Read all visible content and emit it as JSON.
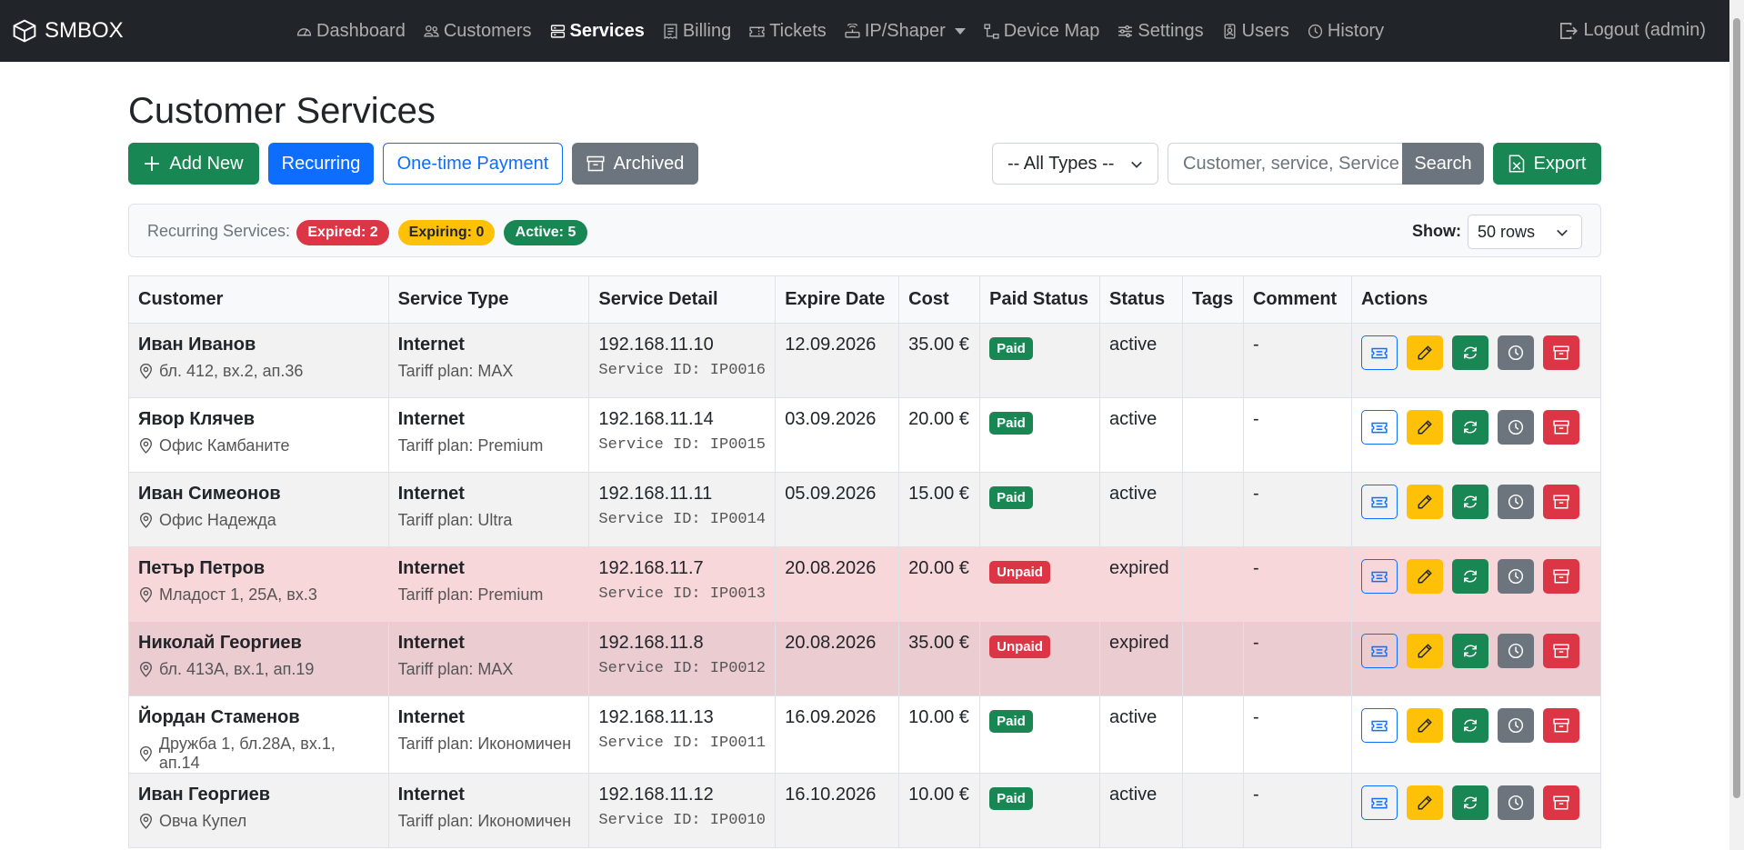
{
  "navbar": {
    "brand": "SMBOX",
    "links": [
      {
        "label": "Dashboard",
        "icon": "speedometer-icon"
      },
      {
        "label": "Customers",
        "icon": "people-icon"
      },
      {
        "label": "Services",
        "icon": "server-icon",
        "active": true
      },
      {
        "label": "Billing",
        "icon": "receipt-icon"
      },
      {
        "label": "Tickets",
        "icon": "ticket-icon"
      },
      {
        "label": "IP/Shaper",
        "icon": "router-icon"
      },
      {
        "label": "Device Map",
        "icon": "diagram-icon"
      },
      {
        "label": "Settings",
        "icon": "sliders-icon"
      },
      {
        "label": "Users",
        "icon": "person-badge-icon"
      },
      {
        "label": "History",
        "icon": "clock-icon"
      }
    ],
    "logout": "Logout (admin)"
  },
  "page": {
    "title": "Customer Services"
  },
  "toolbar": {
    "add_new": "Add New",
    "recurring": "Recurring",
    "one_time": "One-time Payment",
    "archived": "Archived",
    "type_filter": "-- All Types --",
    "search_placeholder": "Customer, service, Service ID",
    "search_button": "Search",
    "export": "Export"
  },
  "summary": {
    "label": "Recurring Services:",
    "expired": "Expired: 2",
    "expiring": "Expiring: 0",
    "active": "Active: 5",
    "show_label": "Show:",
    "rows": "50 rows"
  },
  "table": {
    "headers": [
      "Customer",
      "Service Type",
      "Service Detail",
      "Expire Date",
      "Cost",
      "Paid Status",
      "Status",
      "Tags",
      "Comment",
      "Actions"
    ],
    "rows": [
      {
        "name": "Иван Иванов",
        "address": "бл. 412, вх.2, ап.36",
        "type": "Internet",
        "plan": "Tariff plan: MAX",
        "ip": "192.168.11.10",
        "service_id": "Service ID: IP0016",
        "expire": "12.09.2026",
        "cost": "35.00 €",
        "paid": "Paid",
        "status": "active",
        "tags": "",
        "comment": "-"
      },
      {
        "name": "Явор Клячев",
        "address": "Офис Камбаните",
        "type": "Internet",
        "plan": "Tariff plan: Premium",
        "ip": "192.168.11.14",
        "service_id": "Service ID: IP0015",
        "expire": "03.09.2026",
        "cost": "20.00 €",
        "paid": "Paid",
        "status": "active",
        "tags": "",
        "comment": "-"
      },
      {
        "name": "Иван Симеонов",
        "address": "Офис Надежда",
        "type": "Internet",
        "plan": "Tariff plan: Ultra",
        "ip": "192.168.11.11",
        "service_id": "Service ID: IP0014",
        "expire": "05.09.2026",
        "cost": "15.00 €",
        "paid": "Paid",
        "status": "active",
        "tags": "",
        "comment": "-"
      },
      {
        "name": "Петър Петров",
        "address": "Младост 1, 25А, вх.3",
        "type": "Internet",
        "plan": "Tariff plan: Premium",
        "ip": "192.168.11.7",
        "service_id": "Service ID: IP0013",
        "expire": "20.08.2026",
        "cost": "20.00 €",
        "paid": "Unpaid",
        "status": "expired",
        "tags": "",
        "comment": "-"
      },
      {
        "name": "Николай Георгиев",
        "address": "бл. 413А, вх.1, ап.19",
        "type": "Internet",
        "plan": "Tariff plan: MAX",
        "ip": "192.168.11.8",
        "service_id": "Service ID: IP0012",
        "expire": "20.08.2026",
        "cost": "35.00 €",
        "paid": "Unpaid",
        "status": "expired",
        "tags": "",
        "comment": "-"
      },
      {
        "name": "Йордан Стаменов",
        "address": "Дружба 1, бл.28А, вх.1, ап.14",
        "type": "Internet",
        "plan": "Tariff plan: Икономичен",
        "ip": "192.168.11.13",
        "service_id": "Service ID: IP0011",
        "expire": "16.09.2026",
        "cost": "10.00 €",
        "paid": "Paid",
        "status": "active",
        "tags": "",
        "comment": "-"
      },
      {
        "name": "Иван Георгиев",
        "address": "Овча Купел",
        "type": "Internet",
        "plan": "Tariff plan: Икономичен",
        "ip": "192.168.11.12",
        "service_id": "Service ID: IP0010",
        "expire": "16.10.2026",
        "cost": "10.00 €",
        "paid": "Paid",
        "status": "active",
        "tags": "",
        "comment": "-"
      }
    ]
  },
  "colors": {
    "navbar": "#212529",
    "success": "#198754",
    "primary": "#0d6efd",
    "secondary": "#6c757d",
    "danger": "#dc3545",
    "warning": "#ffc107"
  }
}
